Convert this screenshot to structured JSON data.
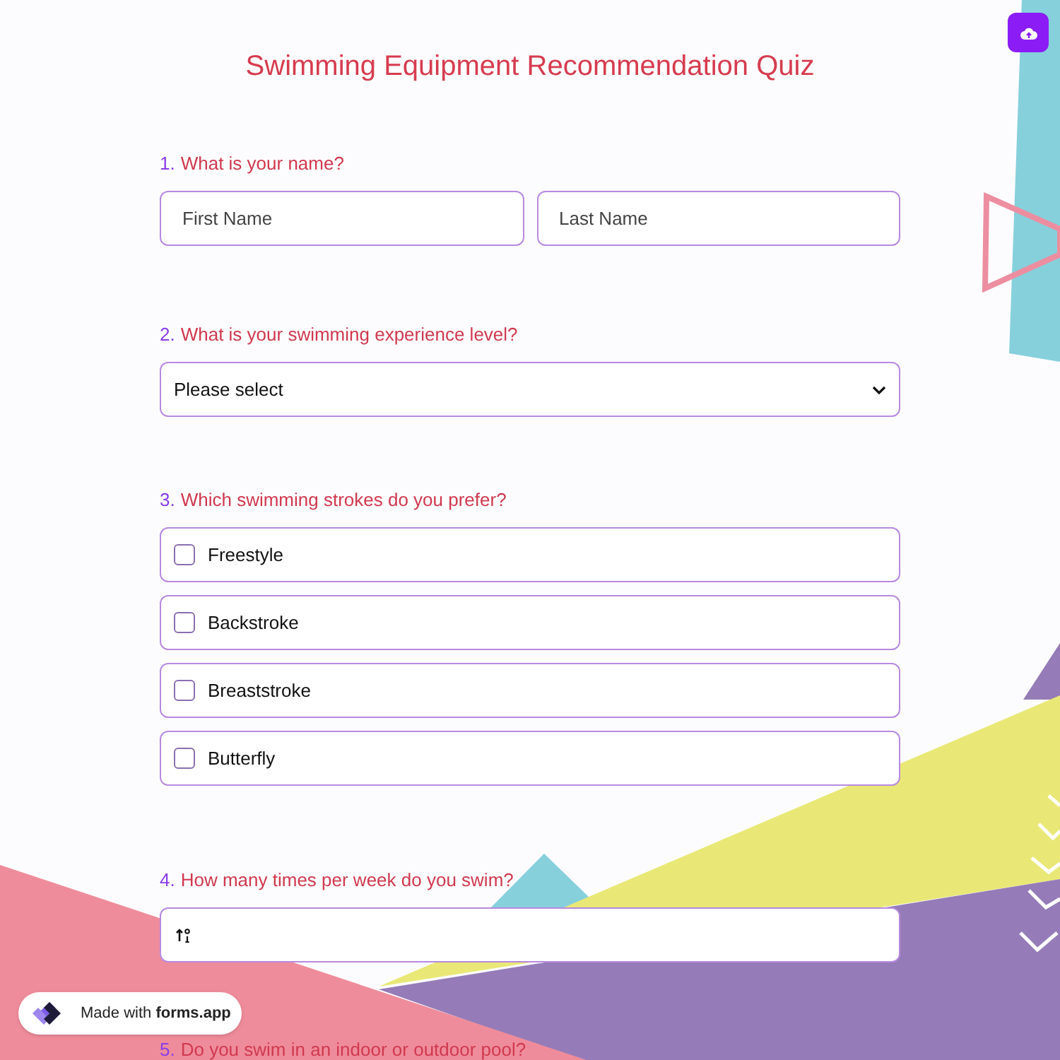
{
  "title": "Swimming Equipment Recommendation Quiz",
  "questions": [
    {
      "number": "1.",
      "text": "What is your name?",
      "kind": "name",
      "fields": [
        {
          "placeholder": "First Name"
        },
        {
          "placeholder": "Last Name"
        }
      ]
    },
    {
      "number": "2.",
      "text": "What is your swimming experience level?",
      "kind": "select",
      "value": "Please select"
    },
    {
      "number": "3.",
      "text": "Which swimming strokes do you prefer?",
      "kind": "checkboxes",
      "options": [
        {
          "label": "Freestyle",
          "checked": false
        },
        {
          "label": "Backstroke",
          "checked": false
        },
        {
          "label": "Breaststroke",
          "checked": false
        },
        {
          "label": "Butterfly",
          "checked": false
        }
      ]
    },
    {
      "number": "4.",
      "text": "How many times per week do you swim?",
      "kind": "number"
    },
    {
      "number": "5.",
      "text": "Do you swim in an indoor or outdoor pool?",
      "kind": "heading"
    }
  ],
  "badge": {
    "prefix": "Made with",
    "brand": "forms.app"
  }
}
